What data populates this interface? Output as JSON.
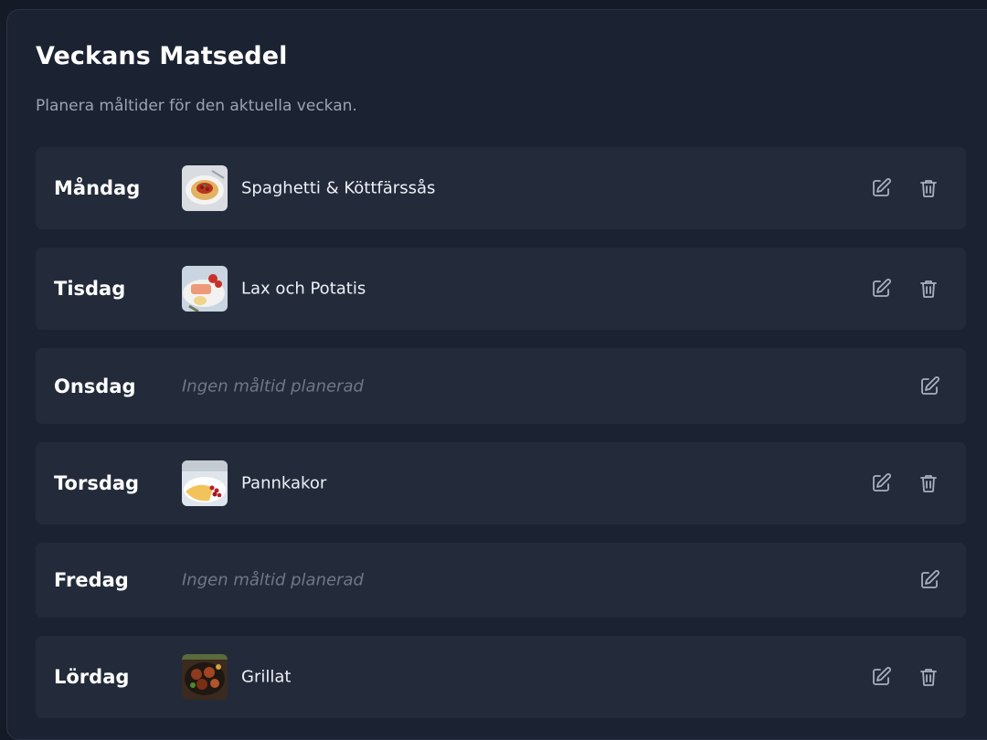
{
  "header": {
    "title": "Veckans Matsedel",
    "subtitle": "Planera måltider för den aktuella veckan."
  },
  "days": [
    {
      "day": "Måndag",
      "meal": "Spaghetti & Köttfärssås",
      "image": "spaghetti-image"
    },
    {
      "day": "Tisdag",
      "meal": "Lax och Potatis",
      "image": "salmon-image"
    },
    {
      "day": "Onsdag",
      "meal": null,
      "empty_label": "Ingen måltid planerad"
    },
    {
      "day": "Torsdag",
      "meal": "Pannkakor",
      "image": "pancakes-image"
    },
    {
      "day": "Fredag",
      "meal": null,
      "empty_label": "Ingen måltid planerad"
    },
    {
      "day": "Lördag",
      "meal": "Grillat",
      "image": "grill-image"
    }
  ],
  "icons": {
    "edit": "pencil-square-icon",
    "delete": "trash-icon"
  },
  "colors": {
    "background": "#141b27",
    "panel": "#1b2231",
    "row": "#232a3a",
    "muted_text": "#9aa4b4",
    "placeholder_text": "#6f7888"
  }
}
